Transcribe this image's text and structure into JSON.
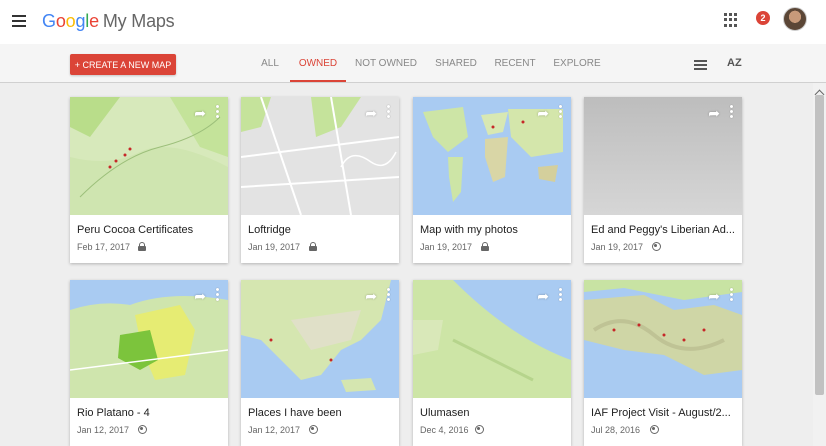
{
  "header": {
    "logo_letters": [
      "G",
      "o",
      "o",
      "g",
      "l",
      "e"
    ],
    "app_name": "My Maps",
    "notification_count": "2"
  },
  "toolbar": {
    "create_label": "+ CREATE A NEW MAP",
    "tabs": [
      {
        "label": "ALL"
      },
      {
        "label": "OWNED"
      },
      {
        "label": "NOT OWNED"
      },
      {
        "label": "SHARED"
      },
      {
        "label": "RECENT"
      },
      {
        "label": "EXPLORE"
      }
    ],
    "active_tab": "OWNED",
    "sort_label": "AZ"
  },
  "maps": [
    {
      "title": "Peru Cocoa Certificates",
      "date": "Feb 17, 2017",
      "access": "private",
      "thumb": "terrain-green"
    },
    {
      "title": "Loftridge",
      "date": "Jan 19, 2017",
      "access": "private",
      "thumb": "street-grey"
    },
    {
      "title": "Map with my photos",
      "date": "Jan 19, 2017",
      "access": "private",
      "thumb": "world"
    },
    {
      "title": "Ed and Peggy's Liberian Ad...",
      "date": "Jan 19, 2017",
      "access": "public",
      "thumb": "blank-grey"
    },
    {
      "title": "Rio Platano - 4",
      "date": "Jan 12, 2017",
      "access": "public",
      "thumb": "regions"
    },
    {
      "title": "Places I have been",
      "date": "Jan 12, 2017",
      "access": "public",
      "thumb": "north-america"
    },
    {
      "title": "Ulumasen",
      "date": "Dec 4, 2016",
      "access": "public",
      "thumb": "coast"
    },
    {
      "title": "IAF Project Visit - August/2...",
      "date": "Jul 28, 2016",
      "access": "public",
      "thumb": "central-america"
    }
  ],
  "colors": {
    "accent": "#db4437",
    "water": "#a9cbf2",
    "land": "#c8e3a3"
  }
}
